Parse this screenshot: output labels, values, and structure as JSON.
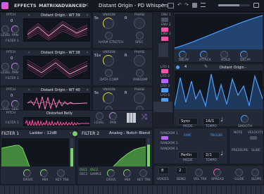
{
  "top": {
    "tabs": [
      "EFFECTS",
      "MATRIX",
      "ADVANCED"
    ],
    "preset": "Distant Origin - PD Whispers",
    "prev": "<",
    "next": ">"
  },
  "osc": [
    {
      "wt": "Distant Origin - WT 39",
      "level": "LEVEL",
      "pan": "PAN",
      "pitch": "PITCH",
      "filter": "FILTER 1",
      "value": "0"
    },
    {
      "wt": "Distant Origin - WT 38",
      "level": "LEVEL",
      "pan": "PAN",
      "pitch": "PITCH",
      "filter": "FILTER 1",
      "value": "0"
    },
    {
      "wt": "Distant Origin - WT 40",
      "level": "LEVEL",
      "pan": "PAN",
      "pitch": "PITCH",
      "filter": "FILTER 1",
      "value": "0"
    }
  ],
  "osc_knobs": [
    {
      "k1": "UNISON",
      "k2": "HARM STRETCH",
      "k3": "PHASE",
      "k4": "SPEC",
      "v1": "5s",
      "v2": "R"
    },
    {
      "k1": "UNISON",
      "k2": "DATA COMP",
      "k3": "PHASE",
      "k4": "RANDOM",
      "v1": "51s",
      "v2": "R"
    },
    {
      "k1": "UNISON",
      "k2": "DATA COMP",
      "k3": "PHASE",
      "k4": "RANDOM",
      "v1": "5s",
      "v2": "R"
    }
  ],
  "sample": {
    "name": "Distorted Belly",
    "pitch": "PITCH",
    "level": "LEVEL",
    "pan": "PAN",
    "filter": "FILTER 1"
  },
  "filter1": {
    "label": "FILTER 1",
    "type": "Ladder : 12dB",
    "knobs": [
      "DRIVE",
      "MIX",
      "KEY TRK"
    ]
  },
  "filter2": {
    "label": "FILTER 2",
    "type": "Analog : Notch Blend",
    "knobs": [
      "DRIVE",
      "MIX",
      "KEY TRK"
    ],
    "routing": [
      "OSC1",
      "OSC2",
      "OSC3",
      "SAMPLE"
    ]
  },
  "env": {
    "items": [
      "ENV 1",
      "ENV 2",
      "ENV 3",
      "LFO 1",
      "LFO 2",
      "LFO 3",
      "LFO 4"
    ],
    "knobs": [
      "DELAY",
      "ATTACK",
      "HOLD",
      "DECAY"
    ],
    "extra_env": "ENV 3"
  },
  "lfo": {
    "title": "Distant Origin -",
    "sync": "Sync",
    "rate": "16/1",
    "mode": "MODE",
    "tempo": "TEMPO",
    "smooth": "SMOOTH",
    "tabs": [
      "SYNC",
      "TRIGGER"
    ],
    "random_items": [
      "RANDOM 1",
      "RANDOM 2",
      "RANDOM 3"
    ],
    "random_mode": "Perlin",
    "random_rate": "2/1",
    "random_mode_lbl": "MODE",
    "random_tempo_lbl": "TEMPO",
    "knob_labels": [
      "STEREO",
      "SLIDE"
    ],
    "side_labels": [
      "NOTE",
      "VELOCITY",
      "PRESSURE",
      "SLIDE"
    ]
  },
  "voices": {
    "voices": "8",
    "voices_lbl": "VOICES",
    "bend": "2",
    "bend_lbl": "BEND",
    "vel_trk": "VEL TRK",
    "spread": "SPREAD",
    "glide": "GLIDE",
    "slope": "SLOPE"
  }
}
